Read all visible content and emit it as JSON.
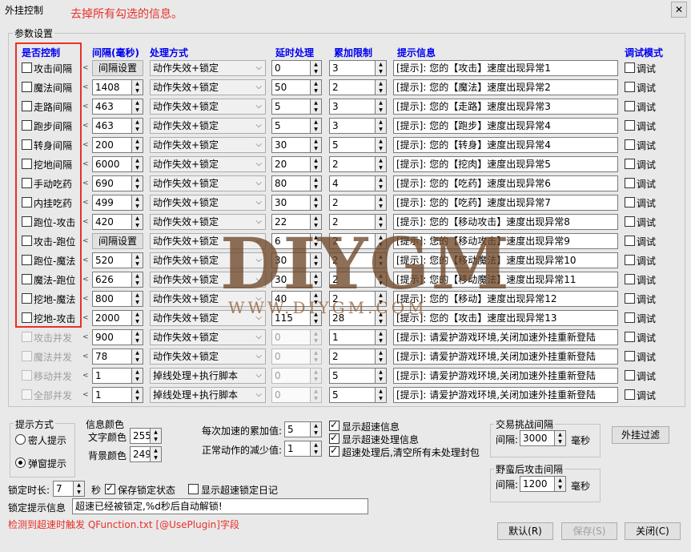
{
  "window": {
    "title": "外挂控制",
    "annotation": "去掉所有勾选的信息。",
    "close_glyph": "✕"
  },
  "params": {
    "group_title": "参数设置",
    "headers": {
      "enable": "是否控制",
      "interval": "间隔(毫秒)",
      "method": "处理方式",
      "delay": "延时处理",
      "accumulate": "累加限制",
      "message": "提示信息",
      "debug": "调试模式"
    },
    "interval_button_label": "间隔设置",
    "debug_label": "调试",
    "rows": [
      {
        "name": "攻击间隔",
        "checked": false,
        "enabled": true,
        "interval": "间隔设置",
        "interval_is_button": true,
        "method": "动作失效+锁定",
        "delay": "0",
        "accumulate": "3",
        "message": "[提示]: 您的【攻击】速度出现异常1",
        "debug": false
      },
      {
        "name": "魔法间隔",
        "checked": false,
        "enabled": true,
        "interval": "1408",
        "interval_is_button": false,
        "method": "动作失效+锁定",
        "delay": "50",
        "accumulate": "2",
        "message": "[提示]: 您的【魔法】速度出现异常2",
        "debug": false
      },
      {
        "name": "走路间隔",
        "checked": false,
        "enabled": true,
        "interval": "463",
        "interval_is_button": false,
        "method": "动作失效+锁定",
        "delay": "5",
        "accumulate": "3",
        "message": "[提示]: 您的【走路】速度出现异常3",
        "debug": false
      },
      {
        "name": "跑步间隔",
        "checked": false,
        "enabled": true,
        "interval": "463",
        "interval_is_button": false,
        "method": "动作失效+锁定",
        "delay": "5",
        "accumulate": "3",
        "message": "[提示]: 您的【跑步】速度出现异常4",
        "debug": false
      },
      {
        "name": "转身间隔",
        "checked": false,
        "enabled": true,
        "interval": "200",
        "interval_is_button": false,
        "method": "动作失效+锁定",
        "delay": "30",
        "accumulate": "5",
        "message": "[提示]: 您的【转身】速度出现异常4",
        "debug": false
      },
      {
        "name": "挖地间隔",
        "checked": false,
        "enabled": true,
        "interval": "6000",
        "interval_is_button": false,
        "method": "动作失效+锁定",
        "delay": "20",
        "accumulate": "2",
        "message": "[提示]: 您的【挖肉】速度出现异常5",
        "debug": false
      },
      {
        "name": "手动吃药",
        "checked": false,
        "enabled": true,
        "interval": "690",
        "interval_is_button": false,
        "method": "动作失效+锁定",
        "delay": "80",
        "accumulate": "4",
        "message": "[提示]: 您的【吃药】速度出现异常6",
        "debug": false
      },
      {
        "name": "内挂吃药",
        "checked": false,
        "enabled": true,
        "interval": "499",
        "interval_is_button": false,
        "method": "动作失效+锁定",
        "delay": "30",
        "accumulate": "2",
        "message": "[提示]: 您的【吃药】速度出现异常7",
        "debug": false
      },
      {
        "name": "跑位-攻击",
        "checked": false,
        "enabled": true,
        "interval": "420",
        "interval_is_button": false,
        "method": "动作失效+锁定",
        "delay": "22",
        "accumulate": "2",
        "message": "[提示]: 您的【移动攻击】速度出现异常8",
        "debug": false
      },
      {
        "name": "攻击-跑位",
        "checked": false,
        "enabled": true,
        "interval": "间隔设置",
        "interval_is_button": true,
        "method": "动作失效+锁定",
        "delay": "6",
        "accumulate": "2",
        "message": "[提示]: 您的【移动攻击】速度出现异常9",
        "debug": false
      },
      {
        "name": "跑位-魔法",
        "checked": false,
        "enabled": true,
        "interval": "520",
        "interval_is_button": false,
        "method": "动作失效+锁定",
        "delay": "30",
        "accumulate": "2",
        "message": "[提示]: 您的【移动魔法】速度出现异常10",
        "debug": false
      },
      {
        "name": "魔法-跑位",
        "checked": false,
        "enabled": true,
        "interval": "626",
        "interval_is_button": false,
        "method": "动作失效+锁定",
        "delay": "30",
        "accumulate": "2",
        "message": "[提示]: 您的【移动魔法】速度出现异常11",
        "debug": false
      },
      {
        "name": "挖地-魔法",
        "checked": false,
        "enabled": true,
        "interval": "800",
        "interval_is_button": false,
        "method": "动作失效+锁定",
        "delay": "40",
        "accumulate": "2",
        "message": "[提示]: 您的【移动】速度出现异常12",
        "debug": false
      },
      {
        "name": "挖地-攻击",
        "checked": false,
        "enabled": true,
        "interval": "2000",
        "interval_is_button": false,
        "method": "动作失效+锁定",
        "delay": "115",
        "accumulate": "28",
        "message": "[提示]: 您的【攻击】速度出现异常13",
        "debug": false
      },
      {
        "name": "攻击并发",
        "checked": false,
        "enabled": false,
        "interval": "900",
        "interval_is_button": false,
        "method": "动作失效+锁定",
        "delay": "0",
        "accumulate": "1",
        "message": "[提示]: 请爱护游戏环境,关闭加速外挂重新登陆",
        "debug": false
      },
      {
        "name": "魔法并发",
        "checked": false,
        "enabled": false,
        "interval": "78",
        "interval_is_button": false,
        "method": "动作失效+锁定",
        "delay": "0",
        "accumulate": "2",
        "message": "[提示]: 请爱护游戏环境,关闭加速外挂重新登陆",
        "debug": false
      },
      {
        "name": "移动并发",
        "checked": false,
        "enabled": false,
        "interval": "1",
        "interval_is_button": false,
        "method": "掉线处理+执行脚本",
        "delay": "0",
        "accumulate": "5",
        "message": "[提示]: 请爱护游戏环境,关闭加速外挂重新登陆",
        "debug": false
      },
      {
        "name": "全部并发",
        "checked": false,
        "enabled": false,
        "interval": "1",
        "interval_is_button": false,
        "method": "掉线处理+执行脚本",
        "delay": "0",
        "accumulate": "5",
        "message": "[提示]: 请爱护游戏环境,关闭加速外挂重新登陆",
        "debug": false
      }
    ]
  },
  "prompt_mode": {
    "title": "提示方式",
    "options": [
      "密人提示",
      "弹窗提示"
    ],
    "selected": 1
  },
  "info_color": {
    "title": "信息颜色",
    "text_label": "文字颜色",
    "text_value": "255",
    "bg_label": "背景颜色",
    "bg_value": "249"
  },
  "accum": {
    "per_label": "每次加速的累加值:",
    "per_value": "5",
    "reduce_label": "正常动作的减少值:",
    "reduce_value": "1"
  },
  "flags": [
    {
      "label": "显示超速信息",
      "checked": true
    },
    {
      "label": "显示超速处理信息",
      "checked": true
    },
    {
      "label": "超速处理后,清空所有未处理封包",
      "checked": true
    }
  ],
  "trade": {
    "title": "交易挑战间隔",
    "label": "间隔:",
    "value": "3000",
    "unit": "毫秒"
  },
  "savage": {
    "title": "野蛮后攻击间隔",
    "label": "间隔:",
    "value": "1200",
    "unit": "毫秒"
  },
  "filter_button": "外挂过滤",
  "lock": {
    "duration_label": "锁定时长:",
    "duration_value": "7",
    "unit": "秒",
    "save_label": "保存锁定状态",
    "save_checked": true,
    "log_label": "显示超速锁定日记",
    "log_checked": false
  },
  "lock_msg": {
    "label": "锁定提示信息",
    "value": "超速已经被锁定,%d秒后自动解锁!"
  },
  "bottom_note": "检测到超速时触发 QFunction.txt [@UsePlugin]字段",
  "buttons": {
    "default": "默认(R)",
    "save": "保存(S)",
    "close": "关闭(C)"
  },
  "watermark": {
    "logo": "DIYGM",
    "url": "WWW.DIYGM.COM"
  },
  "colors": {
    "accent_red": "#e8312a",
    "header_blue": "#0000f0"
  }
}
